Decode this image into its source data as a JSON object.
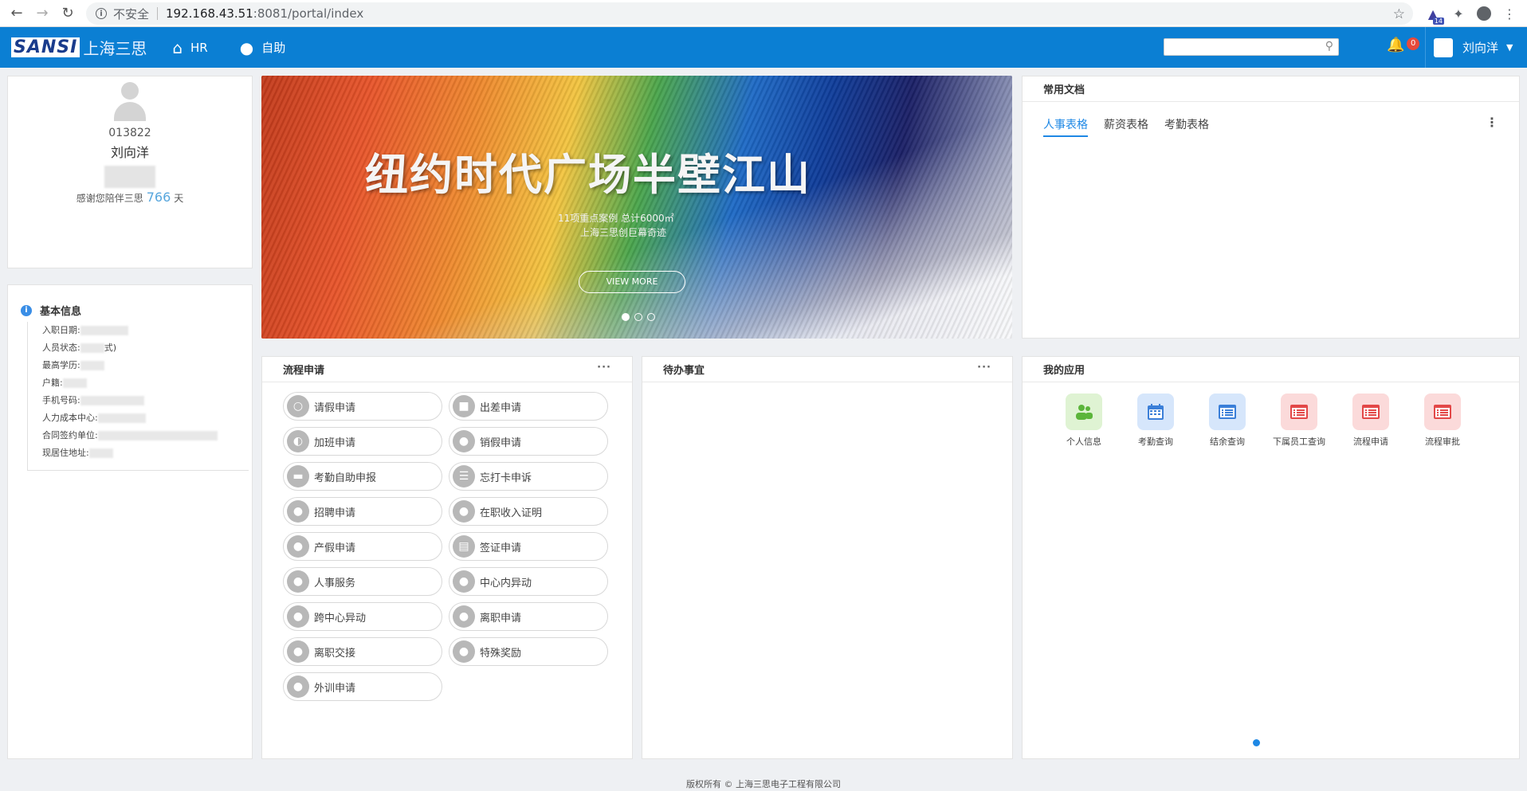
{
  "browser": {
    "insecure_label": "不安全",
    "url_host": "192.168.43.51",
    "url_path": ":8081/portal/index",
    "ext_badge": "14"
  },
  "header": {
    "logo_en": "SANSI",
    "logo_cn": "上海三思",
    "nav": [
      {
        "label": "HR",
        "icon": "home-icon"
      },
      {
        "label": "自助",
        "icon": "user-icon"
      }
    ],
    "search_placeholder": "",
    "notify_count": "0",
    "username": "刘向洋",
    "colors": {
      "bar": "#0b7fd3"
    }
  },
  "profile": {
    "emp_id": "013822",
    "name": "刘向洋",
    "thanks_prefix": "感谢您陪伴三思",
    "days": "766",
    "days_unit": "天"
  },
  "basic_info": {
    "title": "基本信息",
    "rows": [
      {
        "label": "入职日期:",
        "value": ""
      },
      {
        "label": "人员状态:",
        "value": "式)"
      },
      {
        "label": "最高学历:",
        "value": ""
      },
      {
        "label": "户籍:",
        "value": ""
      },
      {
        "label": "手机号码:",
        "value": ""
      },
      {
        "label": "人力成本中心:",
        "value": ""
      },
      {
        "label": "合同签约单位:",
        "value": ""
      },
      {
        "label": "现居住地址:",
        "value": ""
      }
    ]
  },
  "banner": {
    "headline": "纽约时代广场半壁江山",
    "sub1": "11项重点案例    总计6000㎡",
    "sub2": "上海三思创巨幕奇迹",
    "cta": "VIEW MORE"
  },
  "docs": {
    "title": "常用文档",
    "tabs": [
      "人事表格",
      "薪资表格",
      "考勤表格"
    ],
    "active_tab": "人事表格"
  },
  "process": {
    "title": "流程申请",
    "items": [
      "请假申请",
      "出差申请",
      "加班申请",
      "销假申请",
      "考勤自助申报",
      "忘打卡申诉",
      "招聘申请",
      "在职收入证明",
      "产假申请",
      "签证申请",
      "人事服务",
      "中心内异动",
      "跨中心异动",
      "离职申请",
      "离职交接",
      "特殊奖励",
      "外训申请"
    ]
  },
  "todo": {
    "title": "待办事宜"
  },
  "apps": {
    "title": "我的应用",
    "items": [
      {
        "label": "个人信息",
        "icon": "users-icon",
        "bg": "#dff3d3",
        "fg": "#5bb53a"
      },
      {
        "label": "考勤查询",
        "icon": "calendar-icon",
        "bg": "#d6e6fb",
        "fg": "#3b7fd8"
      },
      {
        "label": "结余查询",
        "icon": "list-icon",
        "bg": "#d6e6fb",
        "fg": "#3b7fd8"
      },
      {
        "label": "下属员工查询",
        "icon": "list-icon",
        "bg": "#fbdada",
        "fg": "#e34848"
      },
      {
        "label": "流程申请",
        "icon": "list-icon",
        "bg": "#fbdada",
        "fg": "#e34848"
      },
      {
        "label": "流程审批",
        "icon": "list-icon",
        "bg": "#fbdada",
        "fg": "#e34848"
      }
    ]
  },
  "footer": {
    "text": "版权所有 © 上海三思电子工程有限公司"
  }
}
